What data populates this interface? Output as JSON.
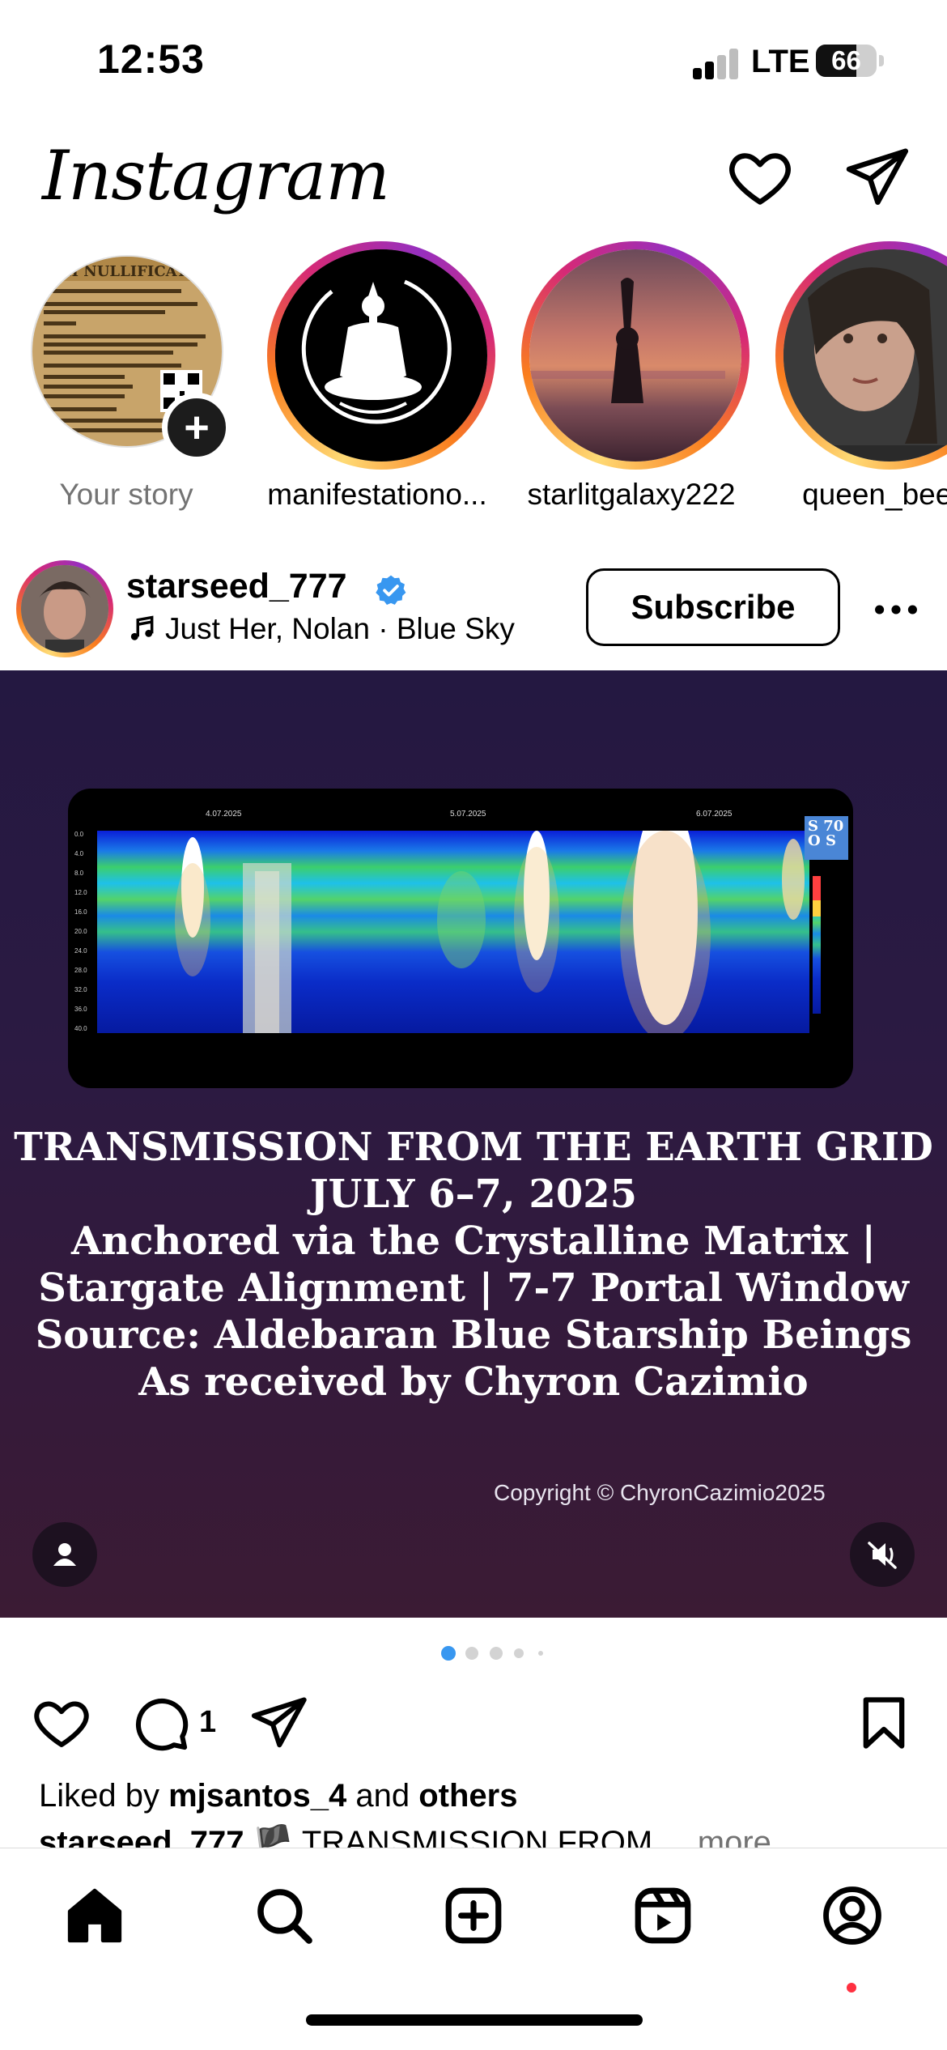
{
  "status_bar": {
    "time": "12:53",
    "network": "LTE",
    "battery": "66",
    "battery_level": 0.66
  },
  "header": {
    "logo": "Instagram",
    "icons": [
      "heart-icon",
      "direct-message-icon"
    ]
  },
  "stories": [
    {
      "label": "Your story",
      "own": true
    },
    {
      "label": "manifestationo..."
    },
    {
      "label": "starlitgalaxy222"
    },
    {
      "label": "queen_bee_"
    }
  ],
  "post": {
    "username": "starseed_777",
    "verified": true,
    "music": "Just Her, Nolan · Blue Sky",
    "subscribe_label": "Subscribe",
    "media": {
      "transmission_lines": [
        "TRANSMISSION FROM THE EARTH GRID",
        "JULY 6–7, 2025",
        "Anchored via the Crystalline Matrix |",
        "Stargate Alignment | 7-7 Portal Window",
        "Source: Aldebaran Blue Starship Beings",
        "As received by Chyron Cazimio"
      ],
      "copyright": "Copyright © ChyronCazimio2025",
      "spectrogram_dates": [
        "4.07.2025",
        "5.07.2025",
        "6.07.2025"
      ],
      "spectrogram_y_ticks": [
        "0.0",
        "4.0",
        "8.0",
        "12.0",
        "16.0",
        "20.0",
        "24.0",
        "28.0",
        "32.0",
        "36.0",
        "40.0"
      ],
      "spectrogram_badge": "S 70 O S"
    },
    "carousel": {
      "count": 5,
      "active": 0
    },
    "comment_count": "1",
    "liked_by_prefix": "Liked by",
    "liked_by_user": "mjsantos_4",
    "liked_by_joiner": "and",
    "liked_by_suffix": "others",
    "caption_user": "starseed_777",
    "caption_preview": "TRANSMISSION FROM",
    "caption_more": "... more"
  },
  "bottom_nav": [
    "home-icon",
    "search-icon",
    "create-icon",
    "reels-icon",
    "profile-icon"
  ],
  "colors": {
    "accent_blue": "#3897f0",
    "notification_red": "#ff3040",
    "media_bg": "#2b1a42"
  }
}
